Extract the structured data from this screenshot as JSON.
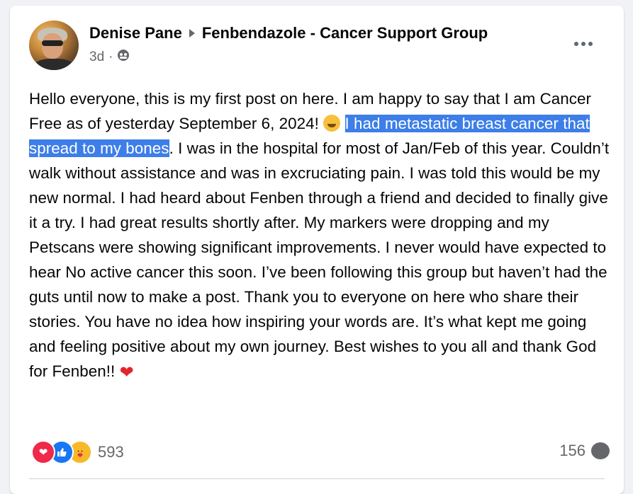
{
  "post": {
    "author": "Denise Pane",
    "group": "Fenbendazole - Cancer Support Group",
    "time": "3d",
    "text_part1": "Hello everyone, this is my first post on here. I am happy to say that I am Cancer Free as of yesterday September 6, 2024! ",
    "text_part2": "  ",
    "text_highlight": "I had metastatic breast cancer that spread to my bones",
    "text_part3": ". I was in the hospital for most of Jan/Feb of this year. Couldn’t walk without assistance and was in excruciating pain. I was told this would be my new normal. I had heard about Fenben through a friend and decided to finally give it a try. I had great results shortly after. My markers were dropping and my Petscans were showing significant improvements. I never would have expected to hear No active cancer this soon. I’ve been following this group but haven’t had the guts until now to make a post. Thank you to everyone on here who share their stories. You have no idea how inspiring your words are. It’s what kept me going and feeling positive about my own journey.  Best wishes to you all and thank God for Fenben!! ",
    "reaction_count": "593",
    "comment_count": "156"
  },
  "icons": {
    "privacy": "group-privacy-icon",
    "more": "more-options-icon",
    "reactions": [
      "love-reaction-icon",
      "like-reaction-icon",
      "care-reaction-icon"
    ],
    "comment": "comment-icon"
  },
  "colors": {
    "highlight": "#3d7ee8",
    "like": "#1877f2",
    "love": "#f0284a",
    "care": "#f7b928",
    "muted": "#65676b"
  }
}
